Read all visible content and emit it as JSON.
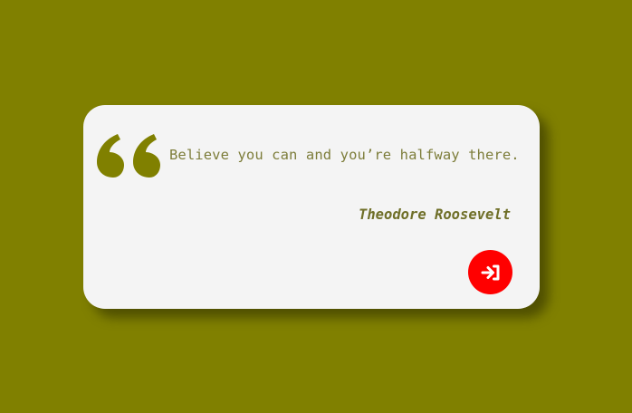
{
  "colors": {
    "background": "#808000",
    "card": "#f4f4f4",
    "quote_mark": "#808000",
    "button": "#ff0000",
    "button_icon": "#ffffff"
  },
  "quote": {
    "text": "Believe you can and you’re halfway there.",
    "author": "Theodore Roosevelt",
    "mark_icon": "quote-left-icon"
  },
  "action_button": {
    "icon": "sign-in-icon"
  }
}
